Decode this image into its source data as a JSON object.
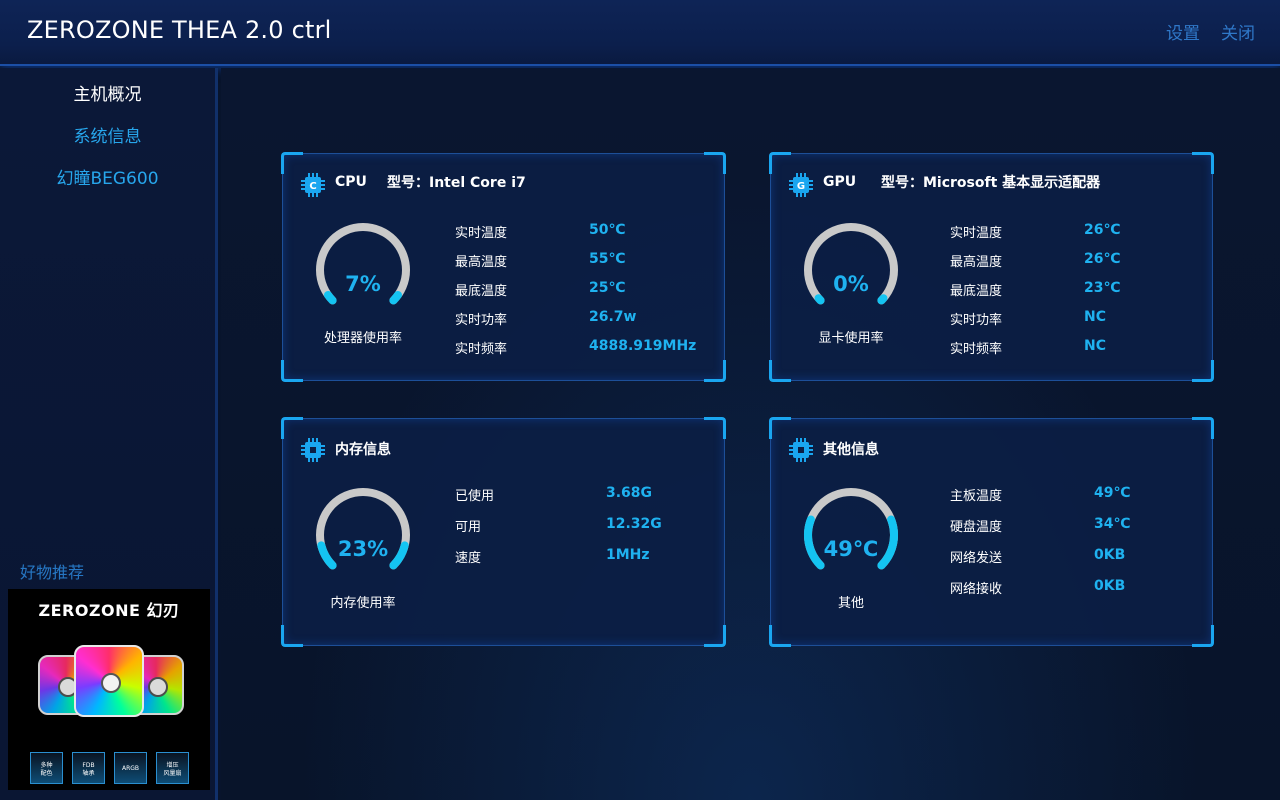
{
  "app": {
    "title": "ZEROZONE THEA 2.0 ctrl",
    "settings_label": "设置",
    "close_label": "关闭"
  },
  "sidebar": {
    "items": [
      {
        "label": "主机概况",
        "active": true
      },
      {
        "label": "系统信息",
        "active": false
      },
      {
        "label": "幻瞳BEG600",
        "active": false
      }
    ],
    "promo": {
      "title": "好物推荐",
      "product": "ZEROZONE 幻刃",
      "features": [
        "多种\n配色",
        "FDB\n轴承",
        "ARGB",
        "增压\n风量扇"
      ]
    }
  },
  "cpu": {
    "name": "CPU",
    "model_label": "型号：Intel Core i7",
    "usage_text": "7%",
    "usage": 7,
    "caption": "处理器使用率",
    "stats": [
      {
        "label": "实时温度",
        "value": "50℃"
      },
      {
        "label": "最高温度",
        "value": "55℃"
      },
      {
        "label": "最底温度",
        "value": "25℃"
      },
      {
        "label": "实时功率",
        "value": "26.7w"
      },
      {
        "label": "实时频率",
        "value": "4888.919MHz"
      }
    ]
  },
  "gpu": {
    "name": "GPU",
    "model_label": "型号：Microsoft 基本显示适配器",
    "usage_text": "0%",
    "usage": 0,
    "caption": "显卡使用率",
    "stats": [
      {
        "label": "实时温度",
        "value": "26℃"
      },
      {
        "label": "最高温度",
        "value": "26℃"
      },
      {
        "label": "最底温度",
        "value": "23℃"
      },
      {
        "label": "实时功率",
        "value": "NC"
      },
      {
        "label": "实时频率",
        "value": "NC"
      }
    ]
  },
  "memory": {
    "name": "内存信息",
    "usage_text": "23%",
    "usage": 23,
    "caption": "内存使用率",
    "stats": [
      {
        "label": "已使用",
        "value": "3.68G"
      },
      {
        "label": "可用",
        "value": "12.32G"
      },
      {
        "label": "速度",
        "value": "1MHz"
      }
    ]
  },
  "other": {
    "name": "其他信息",
    "usage_text": "49℃",
    "usage": 49,
    "caption": "其他",
    "stats": [
      {
        "label": "主板温度",
        "value": "49℃"
      },
      {
        "label": "硬盘温度",
        "value": "34℃"
      },
      {
        "label": "网络发送",
        "value": "0KB"
      },
      {
        "label": "网络接收",
        "value": "0KB"
      }
    ]
  },
  "colors": {
    "accent": "#1fb2f0",
    "gauge_track": "#c9c9c9",
    "gauge_fill": "#14c4f2"
  },
  "icons": {
    "cpu": "cpu-chip-icon",
    "gpu": "gpu-chip-icon",
    "memory": "memory-chip-icon",
    "other": "other-chip-icon"
  }
}
